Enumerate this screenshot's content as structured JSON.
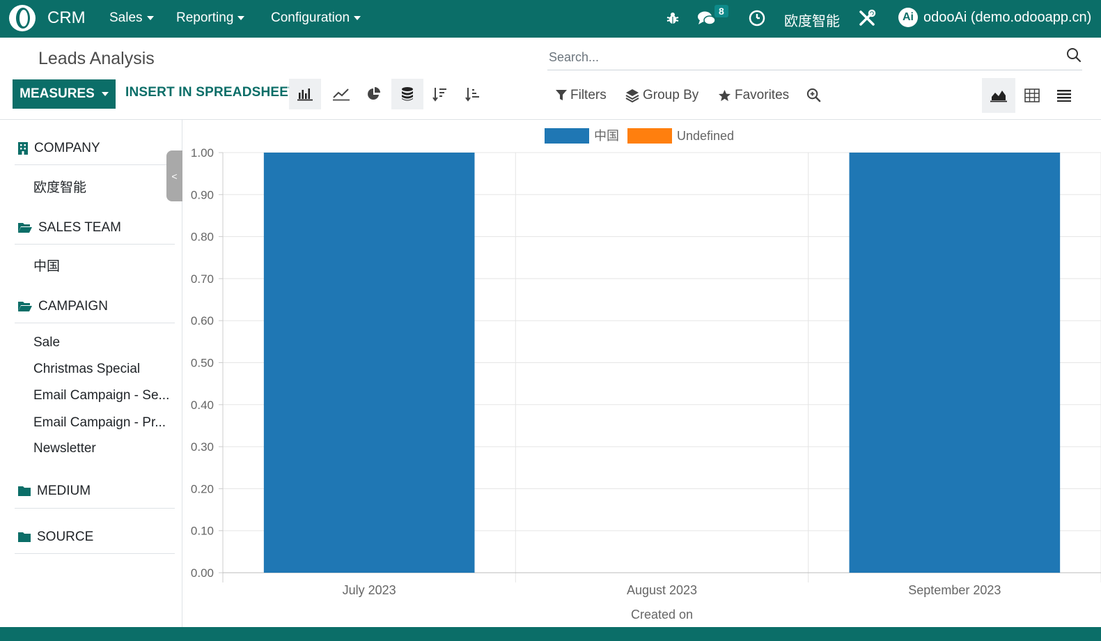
{
  "navbar": {
    "app_name": "CRM",
    "menus": [
      "Sales",
      "Reporting",
      "Configuration"
    ],
    "messages_count": "8",
    "company": "欧度智能",
    "user_initials": "Ai",
    "user": "odooAi (demo.odooapp.cn)",
    "icons": [
      "bug-icon",
      "chat-icon",
      "clock-icon",
      "tools-icon"
    ]
  },
  "control_panel": {
    "breadcrumb": "Leads Analysis",
    "search_placeholder": "Search...",
    "measures_label": "MEASURES",
    "insert_label": "INSERT IN SPREADSHEET",
    "filters_label": "Filters",
    "groupby_label": "Group By",
    "favorites_label": "Favorites"
  },
  "search_panel": {
    "sections": [
      {
        "title": "COMPANY",
        "icon": "building-icon",
        "items": [
          "欧度智能"
        ]
      },
      {
        "title": "SALES TEAM",
        "icon": "folder-open-icon",
        "items": [
          "中国"
        ]
      },
      {
        "title": "CAMPAIGN",
        "icon": "folder-open-icon",
        "items": [
          "Sale",
          "Christmas Special",
          "Email Campaign - Se...",
          "Email Campaign - Pr...",
          "Newsletter"
        ]
      },
      {
        "title": "MEDIUM",
        "icon": "folder-icon",
        "items": []
      },
      {
        "title": "SOURCE",
        "icon": "folder-icon",
        "items": []
      }
    ],
    "toggle_label": "<"
  },
  "colors": {
    "navbar": "#0b6e68",
    "series_1": "#1f77b4",
    "series_2": "#ff7f0e"
  },
  "chart_data": {
    "type": "bar",
    "categories": [
      "July 2023",
      "August 2023",
      "September 2023"
    ],
    "series": [
      {
        "name": "中国",
        "values": [
          1,
          0,
          1
        ],
        "color": "#1f77b4"
      },
      {
        "name": "Undefined",
        "values": [
          0,
          0,
          0
        ],
        "color": "#ff7f0e"
      }
    ],
    "xlabel": "Created on",
    "ylabel": "",
    "ylim": [
      0,
      1
    ],
    "yticks": [
      "0.00",
      "0.10",
      "0.20",
      "0.30",
      "0.40",
      "0.50",
      "0.60",
      "0.70",
      "0.80",
      "0.90",
      "1.00"
    ],
    "grid": true,
    "legend": "top-center"
  }
}
